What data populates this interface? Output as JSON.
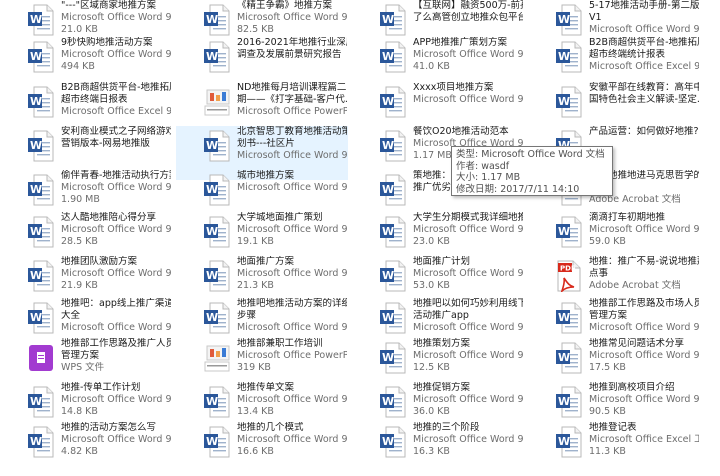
{
  "window": {
    "background": "#ffffff",
    "selection_color": "#e5f3ff"
  },
  "files": [
    {
      "l1": "\"---\"区域商家地推方案",
      "l2": "Microsoft Office Word 9...",
      "l3": "21.0 KB",
      "icon": "word-icon"
    },
    {
      "l1": "9秒快购地推活动方案",
      "l2": "Microsoft Office Word 9...",
      "l3": "494 KB",
      "icon": "word-icon"
    },
    {
      "l1": "B2B商超供货平台-地推拓展-",
      "l2": "超市终端日报表",
      "l3": "Microsoft Office Excel 9...",
      "icon": "word-icon"
    },
    {
      "l1": "安利商业模式之子网络游戏",
      "l2": "营销版本-网易地推版",
      "l3": "",
      "icon": "word-icon"
    },
    {
      "l1": "偷伴青春-地推活动执行方案",
      "l2": "Microsoft Office Word 9...",
      "l3": "1.90 MB",
      "icon": "word-icon"
    },
    {
      "l1": "达人酷地推陪心得分享",
      "l2": "Microsoft Office Word 9...",
      "l3": "28.5 KB",
      "icon": "word-icon"
    },
    {
      "l1": "地推团队激励方案",
      "l2": "Microsoft Office Word 9...",
      "l3": "21.9 KB",
      "icon": "word-icon"
    },
    {
      "l1": "地推吧：app线上推广渠道",
      "l2": "大全",
      "l3": "Microsoft Office Word 9...",
      "icon": "word-icon"
    },
    {
      "l1": "地推部工作思路及推广人员",
      "l2": "管理方案",
      "l3": "WPS 文件",
      "icon": "wps-icon"
    },
    {
      "l1": "地推-传单工作计划",
      "l2": "Microsoft Office Word 9...",
      "l3": "14.8 KB",
      "icon": "word-icon"
    },
    {
      "l1": "地推的活动方案怎么写",
      "l2": "Microsoft Office Word 9...",
      "l3": "4.82 KB",
      "icon": "word-icon"
    },
    {
      "l1": "《精王争霸》地推方案",
      "l2": "Microsoft Office Word 9...",
      "l3": "82.5 KB",
      "icon": "word-icon"
    },
    {
      "l1": "2016-2021年地推行业深度",
      "l2": "调查及发展前景研究报告",
      "l3": "",
      "icon": "word-icon"
    },
    {
      "l1": "ND地推每月培训课程篇二",
      "l2": "期——《打字基础-客户代...",
      "l3": "Microsoft Office PowerP...",
      "icon": "ppt-icon"
    },
    {
      "l1": "北京智思丁教育地推活动策",
      "l2": "划书---社区片",
      "l3": "Microsoft Office Word 9...",
      "icon": "word-icon"
    },
    {
      "l1": "城市地推方案",
      "l2": "Microsoft Office Word 9...",
      "l3": "",
      "icon": "word-icon"
    },
    {
      "l1": "大学城地面推广策划",
      "l2": "Microsoft Office Word 9...",
      "l3": "19.1 KB",
      "icon": "word-icon"
    },
    {
      "l1": "地面推广方案",
      "l2": "Microsoft Office Word 9...",
      "l3": "21.3 KB",
      "icon": "word-icon"
    },
    {
      "l1": "地推吧地推活动方案的详细",
      "l2": "步骤",
      "l3": "Microsoft Office Word 9...",
      "icon": "word-icon"
    },
    {
      "l1": "地推部兼职工作培训",
      "l2": "Microsoft Office PowerP...",
      "l3": "319 KB",
      "icon": "ppt-icon"
    },
    {
      "l1": "地推传单文案",
      "l2": "Microsoft Office Word 9...",
      "l3": "13.4 KB",
      "icon": "word-icon"
    },
    {
      "l1": "地推的几个模式",
      "l2": "Microsoft Office Word 9...",
      "l3": "16.6 KB",
      "icon": "word-icon"
    },
    {
      "l1": "【互联网】融资500万-前孩",
      "l2": "了么高管创立地推众包平台",
      "l3": "",
      "icon": "word-icon"
    },
    {
      "l1": "APP地推推广策划方案",
      "l2": "Microsoft Office Word 9...",
      "l3": "41.0 KB",
      "icon": "word-icon"
    },
    {
      "l1": "Xxxx项目地推方案",
      "l2": "Microsoft Office Word 9...",
      "l3": "",
      "icon": "word-icon"
    },
    {
      "l1": "餐饮O20地推活动范本",
      "l2": "Microsoft Office Word 9...",
      "l3": "1.17 MB",
      "icon": "word-icon"
    },
    {
      "l1": "策地推：论",
      "l2": "推广优劣势",
      "l3": "",
      "icon": "word-icon"
    },
    {
      "l1": "大学生分期模式我详细地推",
      "l2": "Microsoft Office Word 9...",
      "l3": "23.0 KB",
      "icon": "word-icon"
    },
    {
      "l1": "地面推广计划",
      "l2": "Microsoft Office Word 9...",
      "l3": "53.0 KB",
      "icon": "word-icon"
    },
    {
      "l1": "地推吧以如何巧妙利用线下",
      "l2": "活动推广app",
      "l3": "Microsoft Office Word 9...",
      "icon": "word-icon"
    },
    {
      "l1": "地推策划方案",
      "l2": "Microsoft Office Word 9...",
      "l3": "12.5 KB",
      "icon": "word-icon"
    },
    {
      "l1": "地推促销方案",
      "l2": "Microsoft Office Word 9...",
      "l3": "36.0 KB",
      "icon": "word-icon"
    },
    {
      "l1": "地推的三个阶段",
      "l2": "Microsoft Office Word 9...",
      "l3": "16.3 KB",
      "icon": "word-icon"
    },
    {
      "l1": "5-17地推活动手册-第二版",
      "l2": "V1",
      "l3": "Microsoft Office Word 9...",
      "icon": "word-icon"
    },
    {
      "l1": "B2B商超供货平台-地推拓展-",
      "l2": "超市终端统计报表",
      "l3": "Microsoft Office Excel 9...",
      "icon": "word-icon"
    },
    {
      "l1": "安徽平部在线教育：高年中",
      "l2": "国特色社会主义解读-坚定...",
      "l3": "",
      "icon": "word-icon"
    },
    {
      "l1": "产品运营：如何做好地推?",
      "l2": "",
      "l3": "",
      "icon": "word-icon"
    },
    {
      "l1": "…选地推地进马克思哲学的",
      "l2": "究",
      "l3": "Adobe Acrobat 文档",
      "icon": "word-icon"
    },
    {
      "l1": "滴滴打车初期地推",
      "l2": "Microsoft Office Word 9...",
      "l3": "59.0 KB",
      "icon": "word-icon"
    },
    {
      "l1": "地推：推广不易-说说地推那",
      "l2": "点事",
      "l3": "Adobe Acrobat 文档",
      "icon": "pdf-icon"
    },
    {
      "l1": "地推部工作思路及市场人员",
      "l2": "管理方案",
      "l3": "Microsoft Office Word 9...",
      "icon": "word-icon"
    },
    {
      "l1": "地推常见问题话术分享",
      "l2": "Microsoft Office Word 9...",
      "l3": "17.5 KB",
      "icon": "word-icon"
    },
    {
      "l1": "地推到高校项目介绍",
      "l2": "Microsoft Office Word 9...",
      "l3": "90.5 KB",
      "icon": "word-icon"
    },
    {
      "l1": "地推登记表",
      "l2": "Microsoft Office Excel 工...",
      "l3": "11.3 KB",
      "icon": "word-icon"
    }
  ],
  "tooltip": {
    "type_line": "类型: Microsoft Office Word 文档",
    "author_line": "作者: wasdf",
    "size_line": "大小: 1.17 MB",
    "date_line": "修改日期: 2017/7/11 14:10"
  }
}
